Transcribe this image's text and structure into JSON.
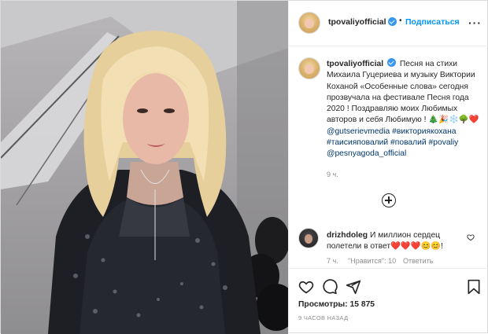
{
  "post": {
    "username": "tpovaliyofficial",
    "dot": "•",
    "follow_label": "Подписаться",
    "more_label": "···"
  },
  "caption": {
    "username": "tpovaliyofficial",
    "text_1": "Песня на стихи Михаила Гуцериева и музыку Виктории Кохaной «Особенные слова» сегодня прозвучала на фестивале Песня года 2020 ! Поздравляю моих Любимых авторов и себя Любимую ! 🎄🎉❄️🌳❤️",
    "hashtags": "@gutserievmedia #викториякохана #таисияповалий #повалий #povaliy @pesnyagoda_official",
    "time": "9 ч."
  },
  "load_more_icon": "plus-circle-icon",
  "comment": {
    "username": "drizhdoleg",
    "text": "И миллион сердец полетели в ответ❤️❤️❤️😊😊!",
    "time": "7 ч.",
    "likes": "\"Нравится\": 10",
    "reply": "Ответить"
  },
  "actions": {
    "like_icon": "heart-icon",
    "comment_icon": "comment-icon",
    "share_icon": "share-icon",
    "save_icon": "bookmark-icon"
  },
  "stats": {
    "views_label": "Просмотры:",
    "views_value": "15 875",
    "posted_ago": "9 ЧАСОВ НАЗАД"
  },
  "colors": {
    "accent": "#0095f6",
    "verified": "#3897f0",
    "muted": "#8e8e8e",
    "link": "#00376b"
  }
}
